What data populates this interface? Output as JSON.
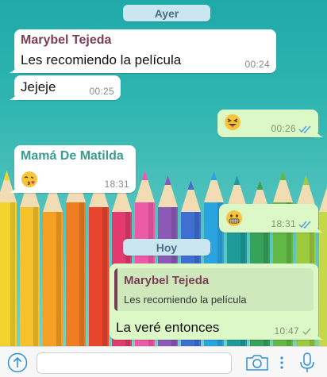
{
  "chat": {
    "date_yesterday": "Ayer",
    "date_today": "Hoy",
    "messages": [
      {
        "sender": "Marybel Tejeda",
        "text": "Les recomiendo la película",
        "time": "00:24"
      },
      {
        "text": "Jejeje",
        "time": "00:25"
      },
      {
        "emoji": "squinting-face-with-tongue",
        "time": "00:26",
        "status": "read"
      },
      {
        "sender": "Mamá De Matilda",
        "emoji": "face-blowing-a-kiss",
        "time": "18:31"
      },
      {
        "emoji": "grimacing-face",
        "time": "18:31",
        "status": "read"
      },
      {
        "quote_sender": "Marybel Tejeda",
        "quote_text": "Les recomiendo la película",
        "text": "La veré entonces",
        "time": "10:47",
        "status": "delivered"
      }
    ]
  },
  "colors": {
    "incoming_bubble": "#ffffff",
    "outgoing_bubble": "#dcf8c6",
    "sender_marybel": "#7b3e57",
    "sender_mama": "#3a9b8e",
    "read_ticks": "#4fa3e0",
    "date_pill": "#c9e6f1"
  },
  "input_bar": {
    "placeholder": "",
    "icons": [
      "share-icon",
      "camera-icon",
      "more-icon",
      "microphone-icon"
    ]
  }
}
